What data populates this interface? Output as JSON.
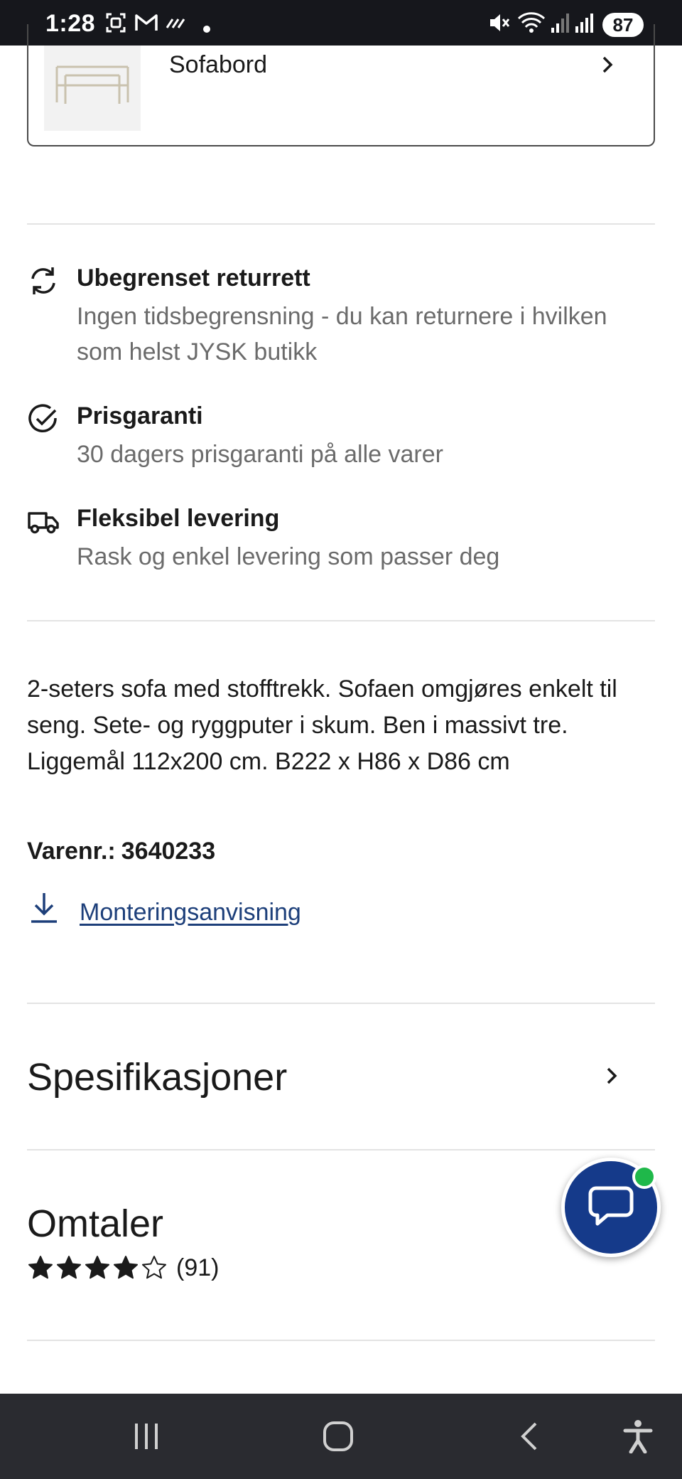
{
  "status_bar": {
    "time": "1:28",
    "battery": "87",
    "left_icons": [
      "screenshot-icon",
      "gmail-icon",
      "mute-swipe-icon"
    ],
    "right_icons": [
      "mute-icon",
      "wifi-6e-icon",
      "signal-icon",
      "signal-roaming-icon"
    ]
  },
  "related_product": {
    "title": "Sofabord"
  },
  "features": [
    {
      "icon": "refresh-icon",
      "title": "Ubegrenset returrett",
      "description": "Ingen tidsbegrensning - du kan returnere i hvilken som helst JYSK butikk"
    },
    {
      "icon": "check-circle-icon",
      "title": "Prisgaranti",
      "description": "30 dagers prisgaranti på alle varer"
    },
    {
      "icon": "truck-icon",
      "title": "Fleksibel levering",
      "description": "Rask og enkel levering som passer deg"
    }
  ],
  "product": {
    "description": "2-seters sofa med stofftrekk. Sofaen omgjøres enkelt til seng. Sete- og ryggputer i skum. Ben i massivt tre. Liggemål 112x200 cm. B222 x H86 x D86 cm",
    "item_number_label": "Varenr.:",
    "item_number": "3640233",
    "manual_link": "Monteringsanvisning"
  },
  "specifications": {
    "title": "Spesifikasjoner"
  },
  "reviews": {
    "title": "Omtaler",
    "rating": 4,
    "max_rating": 5,
    "count": "(91)"
  },
  "colors": {
    "brand_blue": "#153a8a",
    "link_blue": "#1d3f7a",
    "online_green": "#1fb84a"
  }
}
